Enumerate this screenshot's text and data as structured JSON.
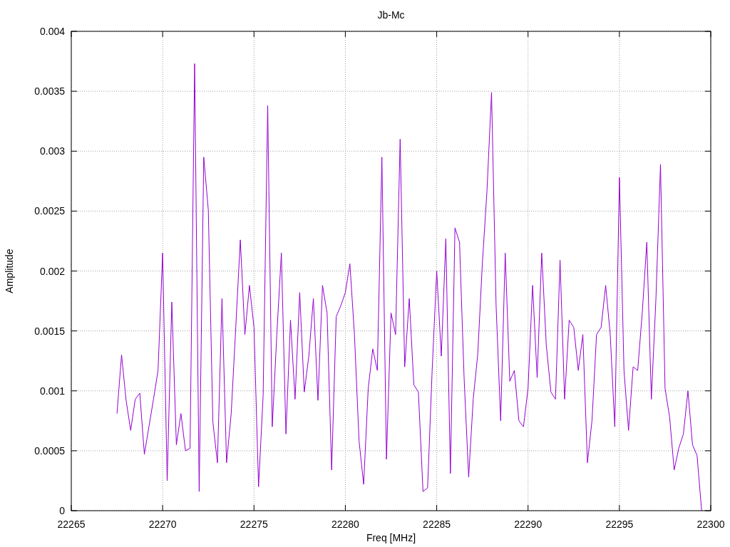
{
  "chart": {
    "chart_data": {
      "type": "line",
      "title": "Jb-Mc",
      "xlabel": "Freq [MHz]",
      "ylabel": "Amplitude",
      "x": [
        22267.5,
        22267.75,
        22268,
        22268.25,
        22268.5,
        22268.75,
        22269,
        22269.25,
        22269.5,
        22269.75,
        22270,
        22270.25,
        22270.5,
        22270.75,
        22271,
        22271.25,
        22271.5,
        22271.75,
        22272,
        22272.25,
        22272.5,
        22272.75,
        22273,
        22273.25,
        22273.5,
        22273.75,
        22274,
        22274.25,
        22274.5,
        22274.75,
        22275,
        22275.25,
        22275.5,
        22275.75,
        22276,
        22276.25,
        22276.5,
        22276.75,
        22277,
        22277.25,
        22277.5,
        22277.75,
        22278,
        22278.25,
        22278.5,
        22278.75,
        22279,
        22279.25,
        22279.5,
        22279.75,
        22280,
        22280.25,
        22280.5,
        22280.75,
        22281,
        22281.25,
        22281.5,
        22281.75,
        22282,
        22282.25,
        22282.5,
        22282.75,
        22283,
        22283.25,
        22283.5,
        22283.75,
        22284,
        22284.25,
        22284.5,
        22284.75,
        22285,
        22285.25,
        22285.5,
        22285.75,
        22286,
        22286.25,
        22286.5,
        22286.75,
        22287,
        22287.25,
        22287.5,
        22287.75,
        22288,
        22288.25,
        22288.5,
        22288.75,
        22289,
        22289.25,
        22289.5,
        22289.75,
        22290,
        22290.25,
        22290.5,
        22290.75,
        22291,
        22291.25,
        22291.5,
        22291.75,
        22292,
        22292.25,
        22292.5,
        22292.75,
        22293,
        22293.25,
        22293.5,
        22293.75,
        22294,
        22294.25,
        22294.5,
        22294.75,
        22295,
        22295.25,
        22295.5,
        22295.75,
        22296,
        22296.25,
        22296.5,
        22296.75,
        22297,
        22297.25,
        22297.5,
        22297.75,
        22298,
        22298.25,
        22298.5,
        22298.75,
        22299,
        22299.25,
        22299.5
      ],
      "series": [
        {
          "color": "#9400d3",
          "values": [
            0.00081,
            0.0013,
            0.00092,
            0.00067,
            0.00093,
            0.00098,
            0.00047,
            0.0007,
            0.00093,
            0.00117,
            0.00215,
            0.00025,
            0.00174,
            0.00055,
            0.00081,
            0.0005,
            0.00052,
            0.00373,
            0.00016,
            0.00295,
            0.00251,
            0.00074,
            0.0004,
            0.00177,
            0.0004,
            0.00081,
            0.00153,
            0.00226,
            0.00147,
            0.00188,
            0.00153,
            0.0002,
            0.00096,
            0.00338,
            0.0007,
            0.00147,
            0.00215,
            0.00064,
            0.00159,
            0.00093,
            0.00182,
            0.00099,
            0.00129,
            0.00177,
            0.00092,
            0.00188,
            0.00165,
            0.00034,
            0.00162,
            0.00171,
            0.00182,
            0.00206,
            0.00147,
            0.00058,
            0.00022,
            0.00102,
            0.00135,
            0.00117,
            0.00295,
            0.00043,
            0.00165,
            0.00147,
            0.0031,
            0.0012,
            0.00177,
            0.00105,
            0.00099,
            0.00016,
            0.00019,
            0.00117,
            0.002,
            0.00129,
            0.00227,
            0.00031,
            0.00236,
            0.00224,
            0.00111,
            0.00028,
            0.00093,
            0.00131,
            0.00206,
            0.00267,
            0.00349,
            0.00171,
            0.00075,
            0.00215,
            0.00108,
            0.00117,
            0.00075,
            0.0007,
            0.00102,
            0.00188,
            0.00111,
            0.00215,
            0.00138,
            0.00099,
            0.00093,
            0.00209,
            0.00093,
            0.00159,
            0.00153,
            0.00117,
            0.00147,
            0.0004,
            0.00075,
            0.00147,
            0.00153,
            0.00188,
            0.00147,
            0.0007,
            0.00278,
            0.00117,
            0.00067,
            0.0012,
            0.00117,
            0.00165,
            0.00224,
            0.00093,
            0.00177,
            0.00289,
            0.00102,
            0.00078,
            0.00034,
            0.00052,
            0.00064,
            0.001,
            0.00055,
            0.00046,
            0
          ]
        }
      ],
      "grid": true,
      "xlim": [
        22265,
        22300
      ],
      "ylim": [
        0,
        0.004
      ],
      "xticks": [
        22265,
        22270,
        22275,
        22280,
        22285,
        22290,
        22295,
        22300
      ],
      "yticks": [
        0,
        0.0005,
        0.001,
        0.0015,
        0.002,
        0.0025,
        0.003,
        0.0035,
        0.004
      ]
    }
  }
}
